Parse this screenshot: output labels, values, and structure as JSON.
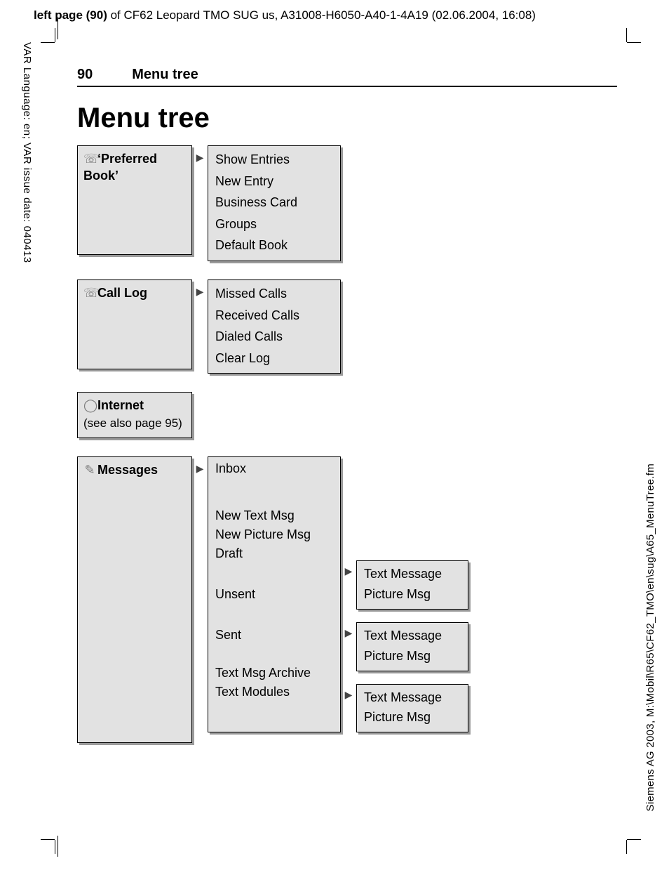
{
  "meta": {
    "top_line_bold": "left page (90)",
    "top_line_rest": " of CF62 Leopard TMO SUG us, A31008-H6050-A40-1-4A19 (02.06.2004, 16:08)",
    "side_left": "VAR Language: en; VAR issue date: 040413",
    "side_right": "Siemens AG 2003, M:\\Mobil\\R65\\CF62_TMO\\en\\sug\\A65_MenuTree.fm"
  },
  "header": {
    "page_number": "90",
    "section": "Menu tree"
  },
  "title": "Menu tree",
  "menu": {
    "preferred_book": {
      "icon": "☏",
      "label": "‘Preferred Book’",
      "items": [
        "Show Entries",
        "New Entry",
        "Business Card",
        "Groups",
        "Default Book"
      ]
    },
    "call_log": {
      "icon": "☏",
      "label": "Call Log",
      "items": [
        "Missed Calls",
        "Received Calls",
        "Dialed Calls",
        "Clear Log"
      ]
    },
    "internet": {
      "icon": "◯",
      "label": "Internet",
      "sub": "(see also page 95)"
    },
    "messages": {
      "icon": "✎",
      "label": "Messages",
      "items": {
        "inbox": "Inbox",
        "new_text": "New Text Msg",
        "new_picture": "New Picture Msg",
        "draft": "Draft",
        "unsent": "Unsent",
        "sent": "Sent",
        "archive": "Text Msg Archive",
        "modules": "Text Modules"
      },
      "sub_draft": [
        "Text Message",
        "Picture Msg"
      ],
      "sub_unsent": [
        "Text Message",
        "Picture Msg"
      ],
      "sub_sent": [
        "Text Message",
        "Picture Msg"
      ]
    }
  }
}
